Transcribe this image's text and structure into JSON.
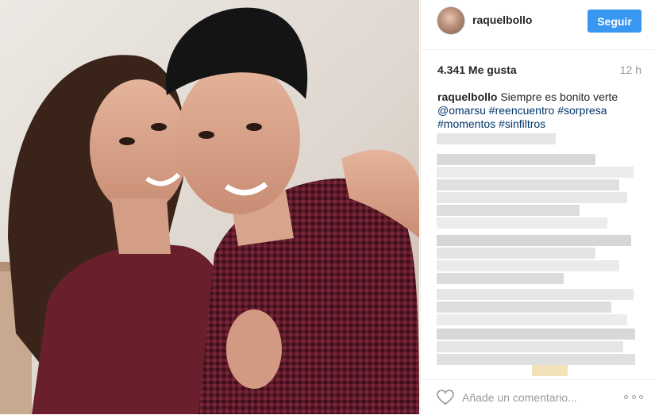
{
  "header": {
    "username": "raquelbollo",
    "follow_label": "Seguir"
  },
  "stats": {
    "likes": "4.341 Me gusta",
    "time": "12 h"
  },
  "caption": {
    "username": "raquelbollo",
    "text": "Siempre es bonito verte",
    "tags": [
      "@omarsu",
      "#reencuentro",
      "#sorpresa",
      "#momentos",
      "#sinfiltros"
    ]
  },
  "comments": {
    "blurred": true
  },
  "footer": {
    "comment_placeholder": "Añade un comentario..."
  },
  "colors": {
    "accent": "#3897f0",
    "link": "#003569",
    "muted": "#999999"
  },
  "icons": {
    "like": "heart-outline-icon",
    "options": "ellipsis-icon"
  }
}
